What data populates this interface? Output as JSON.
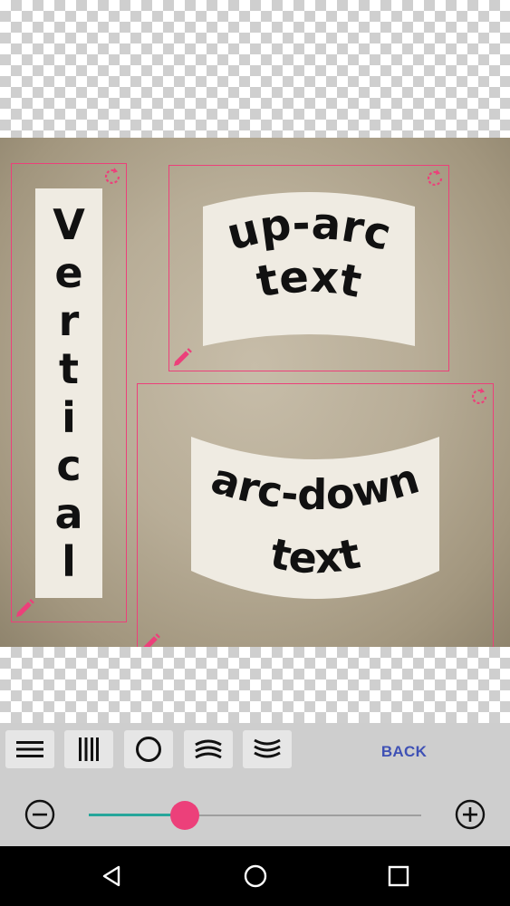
{
  "canvas": {
    "stickers": {
      "vertical": {
        "letters": [
          "V",
          "e",
          "r",
          "t",
          "i",
          "c",
          "a",
          "l"
        ]
      },
      "up_arc": {
        "line1": "up-arc",
        "line2": "text"
      },
      "arc_down": {
        "line1": "arc-down",
        "line2": "text"
      }
    },
    "handle_icons": {
      "rotate": "rotate-icon",
      "edit": "pencil-icon"
    }
  },
  "toolbar": {
    "style_buttons": [
      {
        "id": "horizontal",
        "icon": "horizontal-lines-icon"
      },
      {
        "id": "vertical",
        "icon": "vertical-lines-icon"
      },
      {
        "id": "circle",
        "icon": "circle-icon"
      },
      {
        "id": "arc-up",
        "icon": "arc-up-lines-icon"
      },
      {
        "id": "arc-down",
        "icon": "arc-down-lines-icon"
      }
    ],
    "back_label": "BACK",
    "zoom": {
      "value_fraction": 0.29,
      "minus_icon": "zoom-out-icon",
      "plus_icon": "zoom-in-icon"
    }
  },
  "navbar": {
    "back_icon": "nav-back-icon",
    "home_icon": "nav-home-icon",
    "recents_icon": "nav-recents-icon"
  },
  "colors": {
    "accent": "#ec407a",
    "slider_fill": "#26a69a",
    "back_text": "#3f51b5",
    "toolbar_bg": "#cecece"
  }
}
